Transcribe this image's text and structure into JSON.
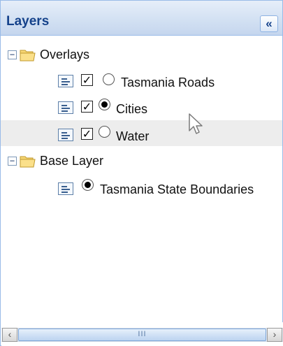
{
  "panel": {
    "title": "Layers",
    "collapse_glyph": "«"
  },
  "tree": {
    "groups": [
      {
        "label": "Overlays",
        "toggle": "−",
        "icon": "folder-open-icon",
        "layers": [
          {
            "label": "Tasmania Roads",
            "checked": true,
            "radio_selected": false,
            "check_glyph": "✓"
          },
          {
            "label": "Cities",
            "checked": true,
            "radio_selected": true,
            "check_glyph": "✓"
          },
          {
            "label": "Water",
            "checked": true,
            "radio_selected": false,
            "check_glyph": "✓",
            "highlighted": true
          }
        ]
      },
      {
        "label": "Base Layer",
        "toggle": "−",
        "icon": "folder-open-icon",
        "layers": [
          {
            "label": "Tasmania State Boundaries",
            "radio_selected": true
          }
        ]
      }
    ]
  },
  "scrollbar": {
    "left_glyph": "‹",
    "right_glyph": "›",
    "grip": "III"
  },
  "colors": {
    "header_text": "#15428b",
    "border": "#99bbe8",
    "selected_row": "#ededed"
  }
}
